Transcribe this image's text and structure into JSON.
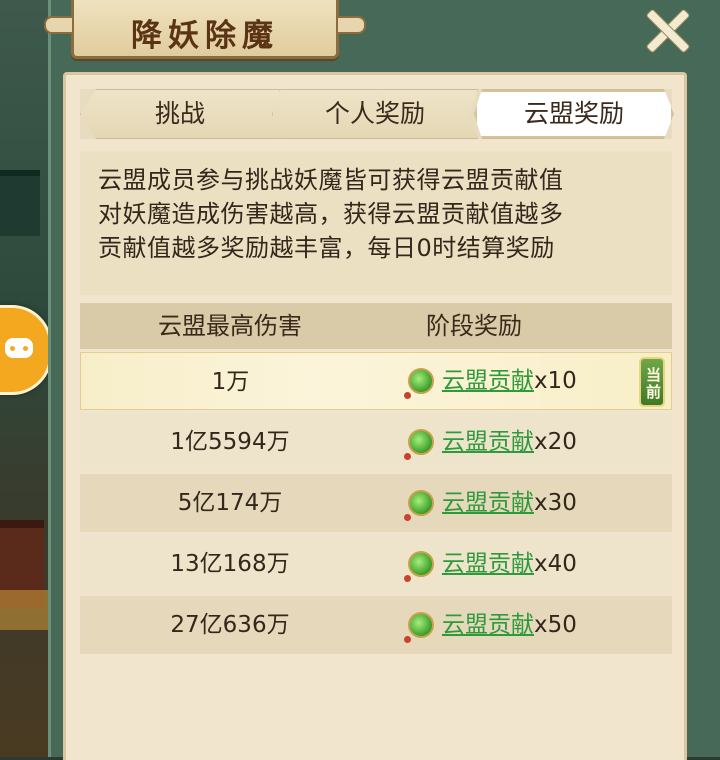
{
  "title": "降妖除魔",
  "tabs": [
    {
      "label": "挑战",
      "active": false
    },
    {
      "label": "个人奖励",
      "active": false
    },
    {
      "label": "云盟奖励",
      "active": true
    }
  ],
  "description": [
    "云盟成员参与挑战妖魔皆可获得云盟贡献值",
    "对妖魔造成伤害越高，获得云盟贡献值越多",
    "贡献值越多奖励越丰富，每日0时结算奖励"
  ],
  "table": {
    "headers": [
      "云盟最高伤害",
      "阶段奖励"
    ],
    "rows": [
      {
        "damage": "1万",
        "reward": "云盟贡献",
        "multiplier": "x10",
        "current": true
      },
      {
        "damage": "1亿5594万",
        "reward": "云盟贡献",
        "multiplier": "x20",
        "current": false
      },
      {
        "damage": "5亿174万",
        "reward": "云盟贡献",
        "multiplier": "x30",
        "current": false
      },
      {
        "damage": "13亿168万",
        "reward": "云盟贡献",
        "multiplier": "x40",
        "current": false
      },
      {
        "damage": "27亿636万",
        "reward": "云盟贡献",
        "multiplier": "x50",
        "current": false
      }
    ],
    "current_badge": "当前"
  },
  "colors": {
    "frame": "#476a58",
    "panel": "#f1e6cd",
    "reward_link": "#2f9a3c",
    "badge": "#4f8e34"
  },
  "icons": {
    "close": "close-x-icon",
    "reward": "contribution-orb-icon",
    "side": "gamepad-icon"
  }
}
